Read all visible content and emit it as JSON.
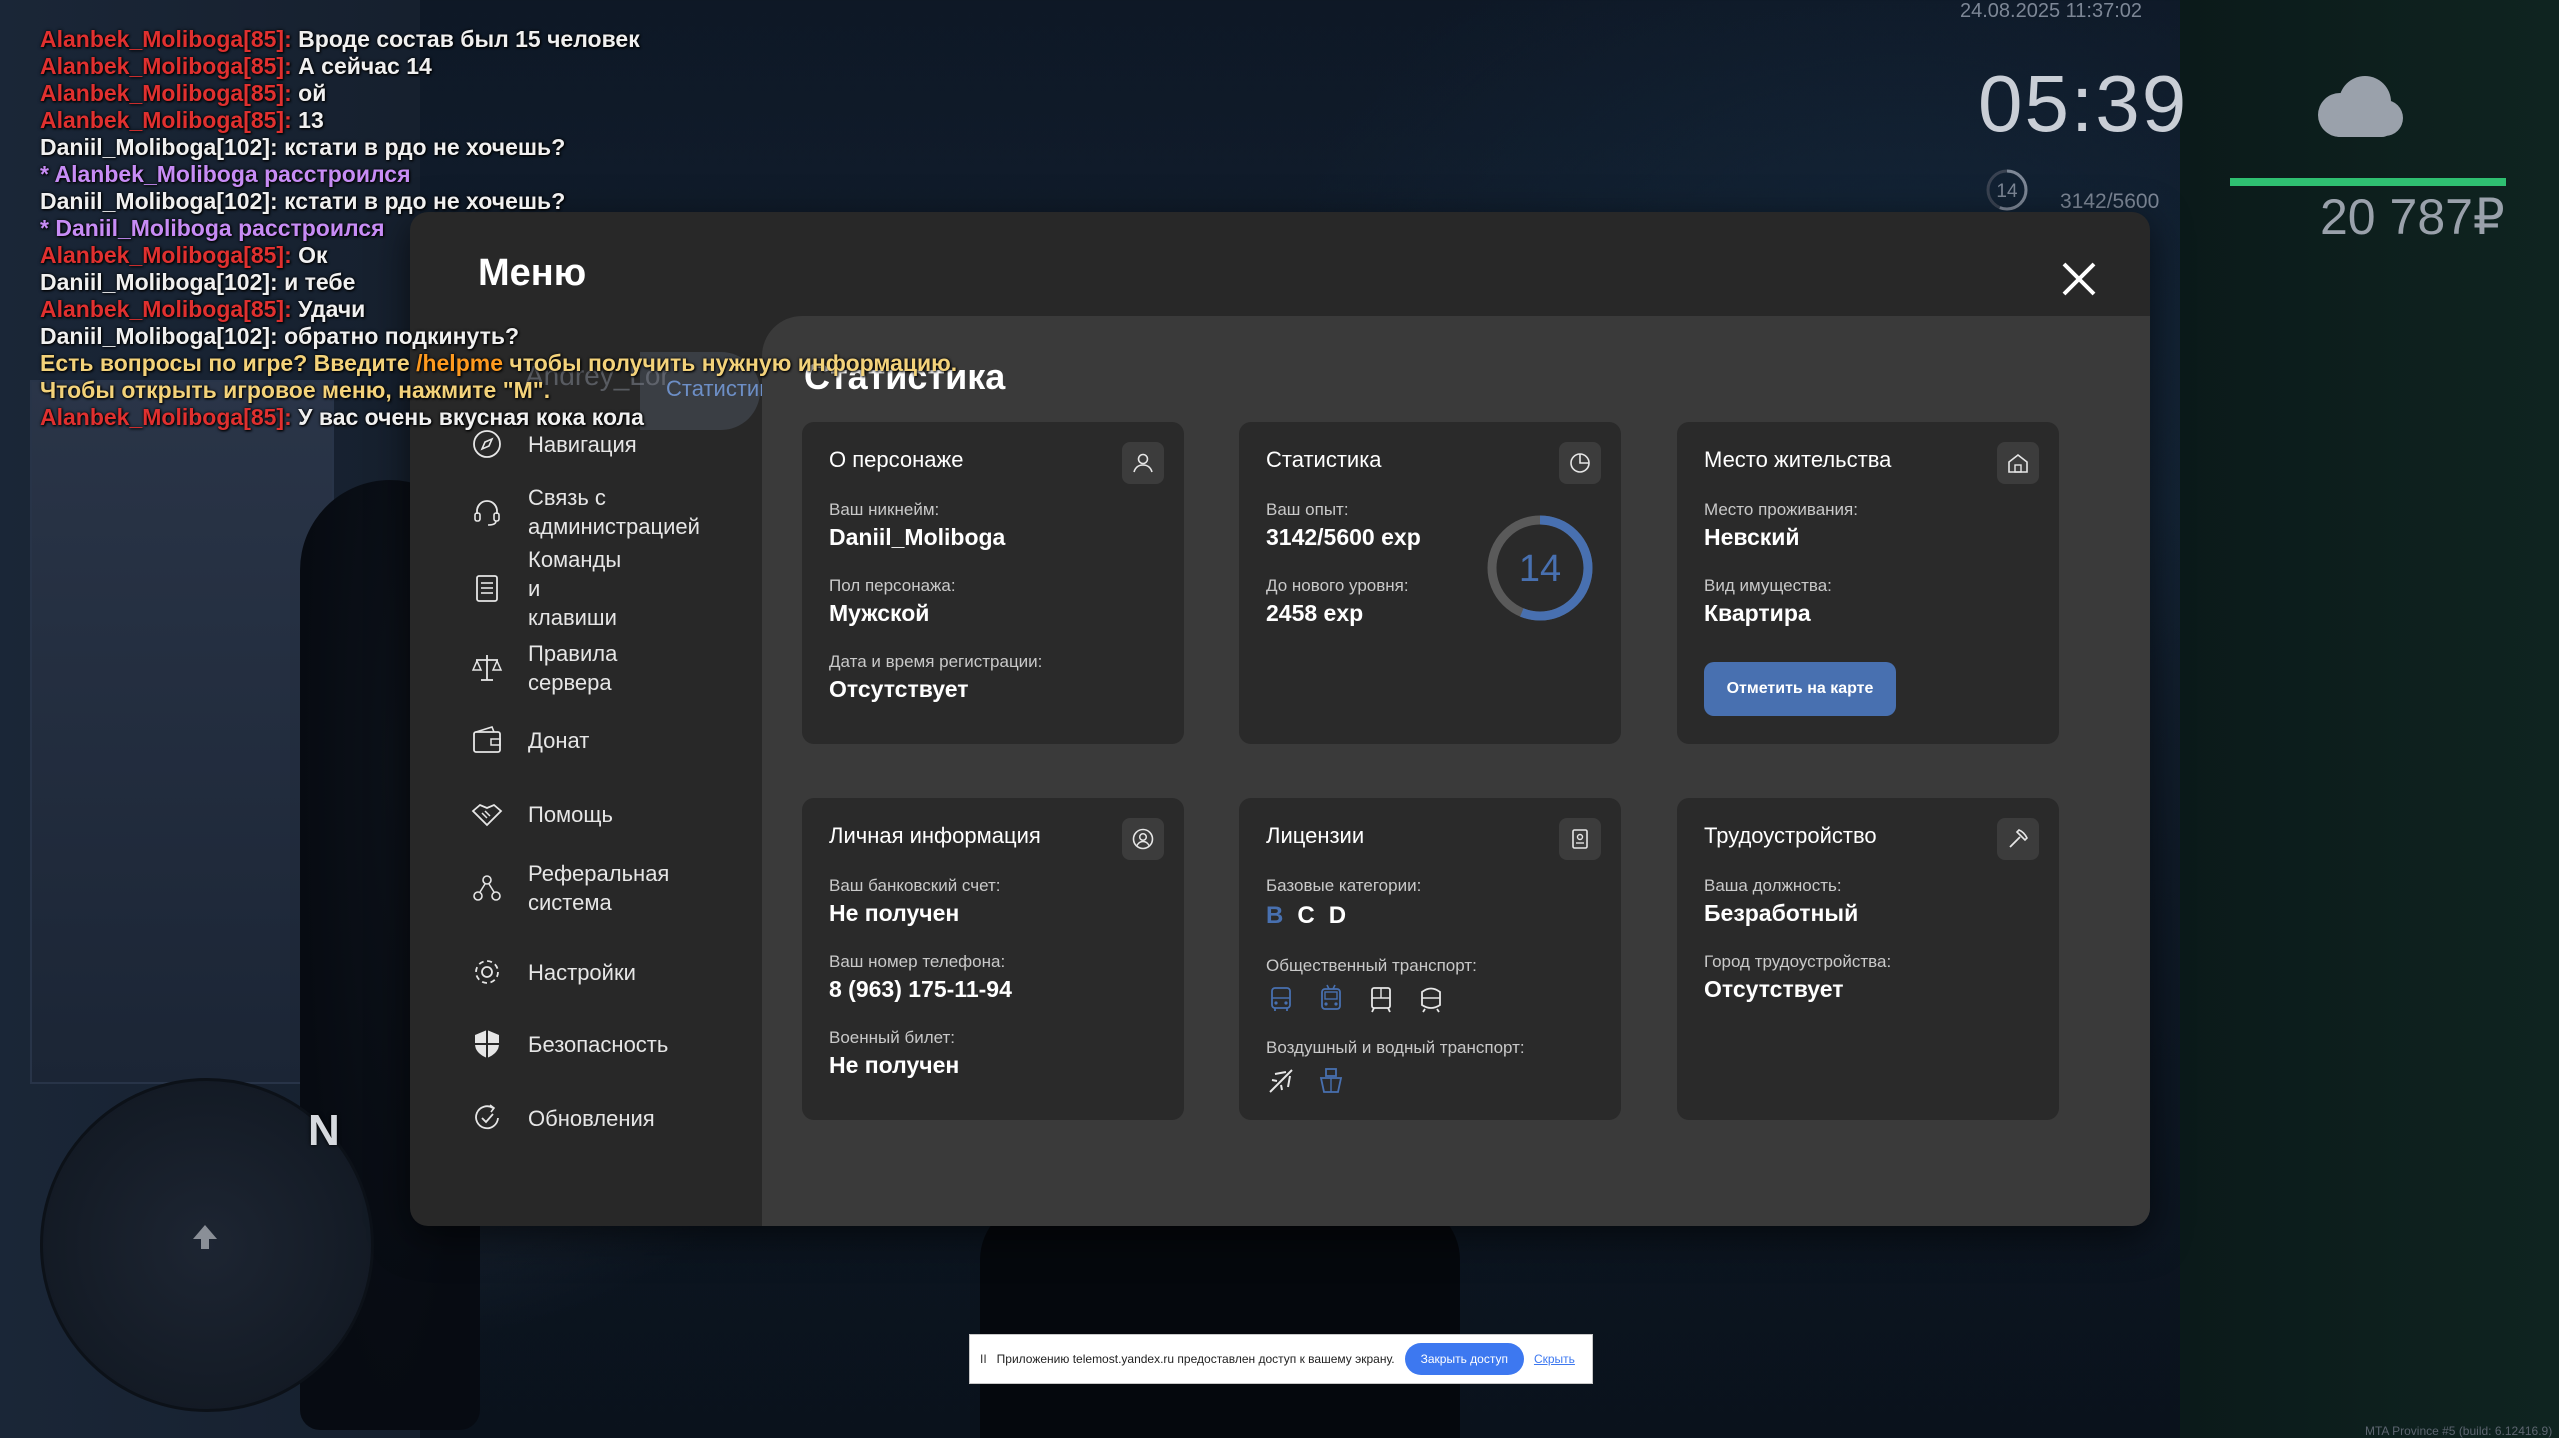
{
  "chat": [
    {
      "parts": [
        {
          "t": "Alanbek_Moliboga[85]:",
          "c": "red"
        },
        {
          "t": " Вроде состав был 15 человек",
          "c": "white"
        }
      ]
    },
    {
      "parts": [
        {
          "t": "Alanbek_Moliboga[85]:",
          "c": "red"
        },
        {
          "t": " А сейчас 14",
          "c": "white"
        }
      ]
    },
    {
      "parts": [
        {
          "t": "Alanbek_Moliboga[85]:",
          "c": "red"
        },
        {
          "t": " ой",
          "c": "white"
        }
      ]
    },
    {
      "parts": [
        {
          "t": "Alanbek_Moliboga[85]:",
          "c": "red"
        },
        {
          "t": " 13",
          "c": "white"
        }
      ]
    },
    {
      "parts": [
        {
          "t": "Daniil_Moliboga[102]: кстати в рдо не хочешь?",
          "c": "white"
        }
      ]
    },
    {
      "parts": [
        {
          "t": "* Alanbek_Moliboga расстроился",
          "c": "purple"
        }
      ]
    },
    {
      "parts": [
        {
          "t": "Daniil_Moliboga[102]: кстати в рдо не хочешь?",
          "c": "white"
        }
      ]
    },
    {
      "parts": [
        {
          "t": "* Daniil_Moliboga расстроился",
          "c": "purple"
        }
      ]
    },
    {
      "parts": [
        {
          "t": "Alanbek_Moliboga[85]:",
          "c": "red"
        },
        {
          "t": " Ок",
          "c": "white"
        }
      ]
    },
    {
      "parts": [
        {
          "t": "Daniil_Moliboga[102]: и тебе",
          "c": "white"
        }
      ]
    },
    {
      "parts": [
        {
          "t": "Alanbek_Moliboga[85]:",
          "c": "red"
        },
        {
          "t": " Удачи",
          "c": "white"
        }
      ]
    },
    {
      "parts": [
        {
          "t": "Daniil_Moliboga[102]: обратно подкинуть?",
          "c": "white"
        }
      ]
    },
    {
      "parts": [
        {
          "t": "Есть вопросы по игре? Введите ",
          "c": "yellow"
        },
        {
          "t": "/helpme",
          "c": "orange"
        },
        {
          "t": " чтобы получить нужную информацию.",
          "c": "yellow"
        }
      ]
    },
    {
      "parts": [
        {
          "t": "Чтобы открыть игровое меню, нажмите \"M\".",
          "c": "yellow"
        }
      ]
    },
    {
      "parts": [
        {
          "t": "Alanbek_Moliboga[85]:",
          "c": "red"
        },
        {
          "t": " У вас очень вкусная кока кола",
          "c": "white"
        }
      ]
    }
  ],
  "hud": {
    "date": "24.08.2025 11:37:02",
    "time": "05:39",
    "level": "14",
    "exp": "3142/5600",
    "money": "20 787₽",
    "weather_icon": "cloud-icon"
  },
  "minimap": {
    "north": "N"
  },
  "menu": {
    "title": "Меню",
    "active_ghost": "Andrey_Lor",
    "active_label": "Статистика",
    "nav": [
      {
        "name": "navigation",
        "label": "Навигация",
        "icon": "compass-icon"
      },
      {
        "name": "contact-admin",
        "label": "Связь с\nадминистрацией",
        "icon": "headset-icon"
      },
      {
        "name": "commands",
        "label": "Команды и\nклавиши",
        "icon": "list-icon"
      },
      {
        "name": "server-rules",
        "label": "Правила сервера",
        "icon": "scales-icon"
      },
      {
        "name": "donate",
        "label": "Донат",
        "icon": "wallet-icon"
      },
      {
        "name": "help",
        "label": "Помощь",
        "icon": "handshake-icon"
      },
      {
        "name": "referral",
        "label": "Реферальная\nсистема",
        "icon": "network-icon"
      },
      {
        "name": "settings",
        "label": "Настройки",
        "icon": "gear-icon"
      },
      {
        "name": "security",
        "label": "Безопасность",
        "icon": "shield-icon"
      },
      {
        "name": "updates",
        "label": "Обновления",
        "icon": "refresh-icon"
      }
    ]
  },
  "stats": {
    "title": "Статистика",
    "character": {
      "title": "О персонаже",
      "icon": "user-icon",
      "nickname_label": "Ваш никнейм:",
      "nickname": "Daniil_Moliboga",
      "gender_label": "Пол персонажа:",
      "gender": "Мужской",
      "reg_label": "Дата и время регистрации:",
      "reg": "Отсутствует"
    },
    "statistics": {
      "title": "Статистика",
      "icon": "chart-icon",
      "exp_label": "Ваш опыт:",
      "exp": "3142/5600 exp",
      "next_label": "До нового уровня:",
      "next": "2458 exp",
      "level": "14",
      "progress": 0.561
    },
    "residence": {
      "title": "Место жительства",
      "icon": "home-icon",
      "place_label": "Место проживания:",
      "place": "Невский",
      "property_label": "Вид имущества:",
      "property": "Квартира",
      "map_button": "Отметить на карте"
    },
    "personal": {
      "title": "Личная информация",
      "icon": "profile-icon",
      "bank_label": "Ваш банковский счет:",
      "bank": "Не получен",
      "phone_label": "Ваш номер телефона:",
      "phone": "8 (963) 175-11-94",
      "military_label": "Военный билет:",
      "military": "Не получен"
    },
    "licenses": {
      "title": "Лицензии",
      "icon": "document-icon",
      "base_label": "Базовые категории:",
      "categories": [
        {
          "t": "B",
          "color": "#4870b0"
        },
        {
          "t": "C",
          "color": "#ffffff"
        },
        {
          "t": "D",
          "color": "#ffffff"
        }
      ],
      "public_label": "Общественный транспорт:",
      "air_label": "Воздушный и водный транспорт:"
    },
    "employment": {
      "title": "Трудоустройство",
      "icon": "hammer-icon",
      "position_label": "Ваша должность:",
      "position": "Безработный",
      "city_label": "Город трудоустройства:",
      "city": "Отсутствует"
    }
  },
  "notification": {
    "pause": "II",
    "text": "Приложению telemost.yandex.ru предоставлен доступ к вашему экрану.",
    "button": "Закрыть доступ",
    "hide": "Скрыть"
  },
  "build": "MTA Province #5 (build: 6.1241​6.9)",
  "colors": {
    "accent": "#4870b0",
    "panel": "#282828",
    "content": "#3a3a3a",
    "card": "#2a2a2a",
    "chat_red": "#e0302f"
  }
}
